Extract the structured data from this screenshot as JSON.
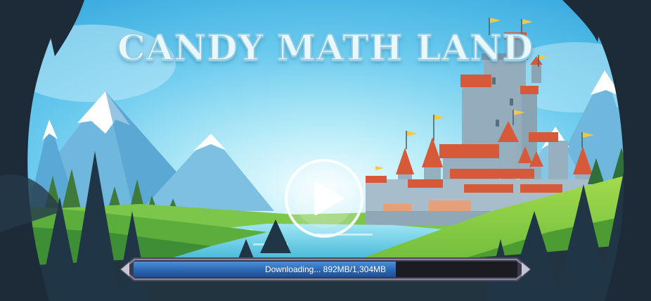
{
  "game": {
    "title": "CANDY MATH LAND"
  },
  "play_button": {
    "icon": "play-icon"
  },
  "download": {
    "status_text": "Downloading... 892MB/1,304MB",
    "progress_fraction": 0.684
  },
  "colors": {
    "sky_top": "#3fb7e6",
    "sky_glow": "#e6fbff",
    "progress_fill": "#2f6cb8",
    "progress_track": "#1b1b22",
    "frame": "#6d6b80",
    "tree_dark": "#1f3140",
    "grass": "#8fd04a"
  }
}
